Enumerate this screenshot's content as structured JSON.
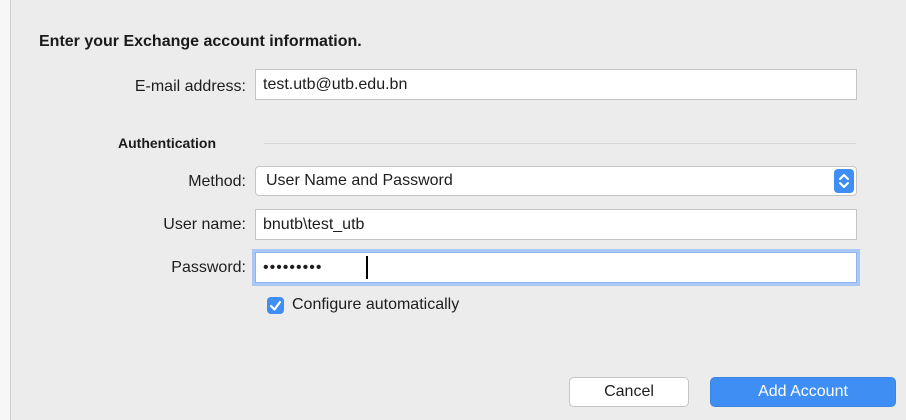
{
  "dialog": {
    "heading": "Enter your Exchange account information."
  },
  "email": {
    "label": "E-mail address:",
    "value": "test.utb@utb.edu.bn"
  },
  "authentication": {
    "section_title": "Authentication",
    "method": {
      "label": "Method:",
      "selected": "User Name and Password"
    },
    "username": {
      "label": "User name:",
      "value": "bnutb\\test_utb"
    },
    "password": {
      "label": "Password:",
      "masked_value": "•••••••••"
    }
  },
  "configure": {
    "label": "Configure automatically",
    "checked": true
  },
  "buttons": {
    "cancel": "Cancel",
    "add_account": "Add Account"
  },
  "colors": {
    "accent": "#3f8ef3",
    "background": "#ececec",
    "focus_ring": "#a9c8f6"
  },
  "icons": {
    "select_stepper": "up-down-chevron-icon",
    "checkbox_mark": "checkmark-icon"
  }
}
